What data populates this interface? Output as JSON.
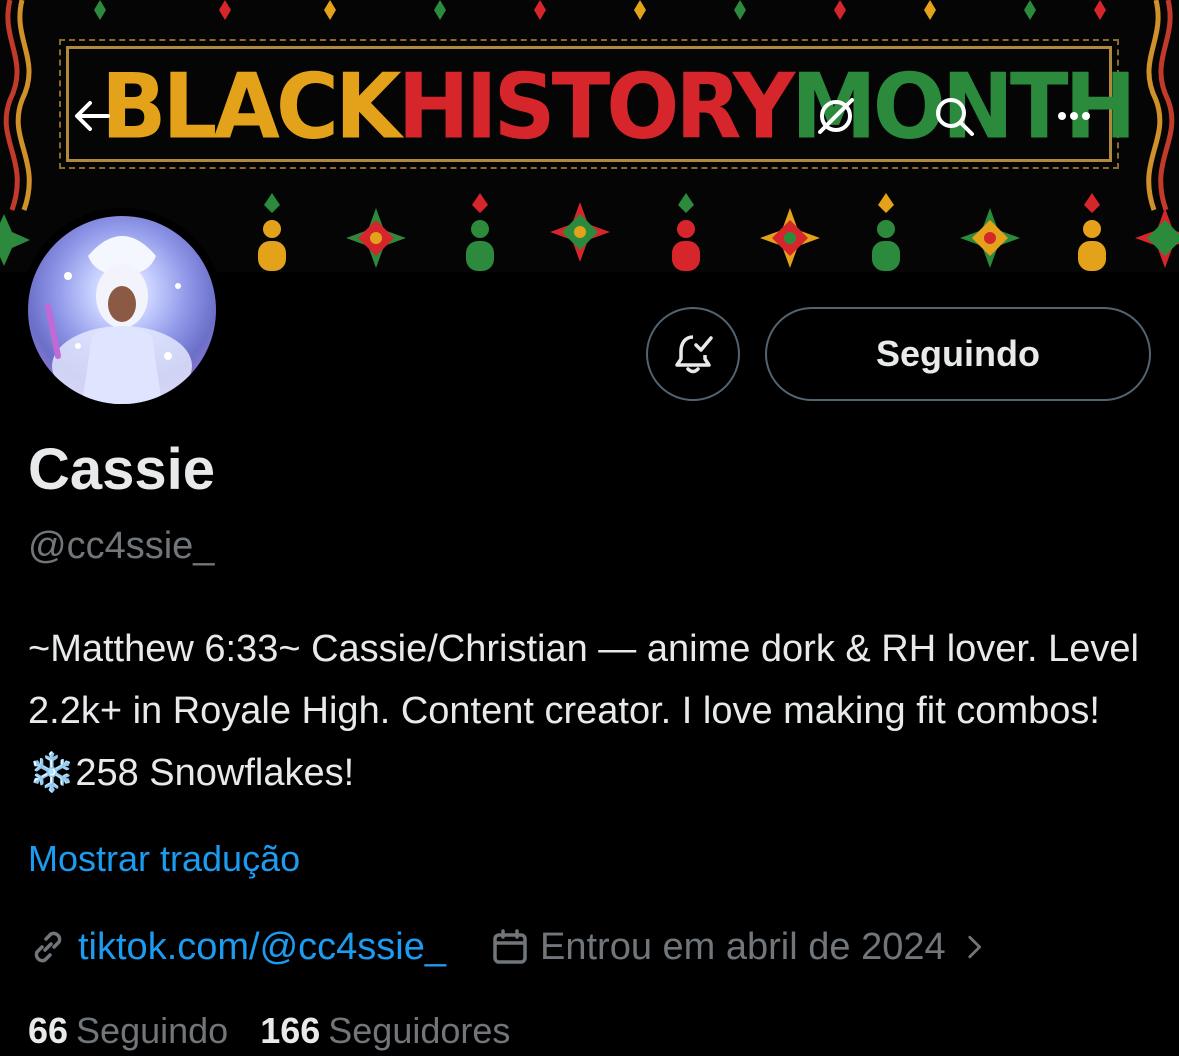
{
  "banner": {
    "title_part1": "BLACK",
    "title_part2": "HISTORY",
    "title_part3": "MONTH"
  },
  "header_icons": {
    "back": "back-arrow-icon",
    "grok": "grok-icon",
    "search": "search-icon",
    "more": "more-icon"
  },
  "profile": {
    "display_name": "Cassie",
    "handle": "@cc4ssie_",
    "bio": "~Matthew 6:33~ Cassie/Christian — anime dork & RH lover. Level 2.2k+ in Royale High. Content creator. I love making fit combos! ❄️258 Snowflakes!",
    "translate_label": "Mostrar tradução",
    "link_text": "tiktok.com/@cc4ssie_",
    "joined_text": "Entrou em abril de 2024",
    "follow_button_label": "Seguindo",
    "following_count": "66",
    "following_label": "Seguindo",
    "followers_count": "166",
    "followers_label": "Seguidores"
  },
  "colors": {
    "link": "#1d9bf0",
    "muted": "#71767b",
    "text": "#e7e9ea",
    "border": "#536471"
  }
}
